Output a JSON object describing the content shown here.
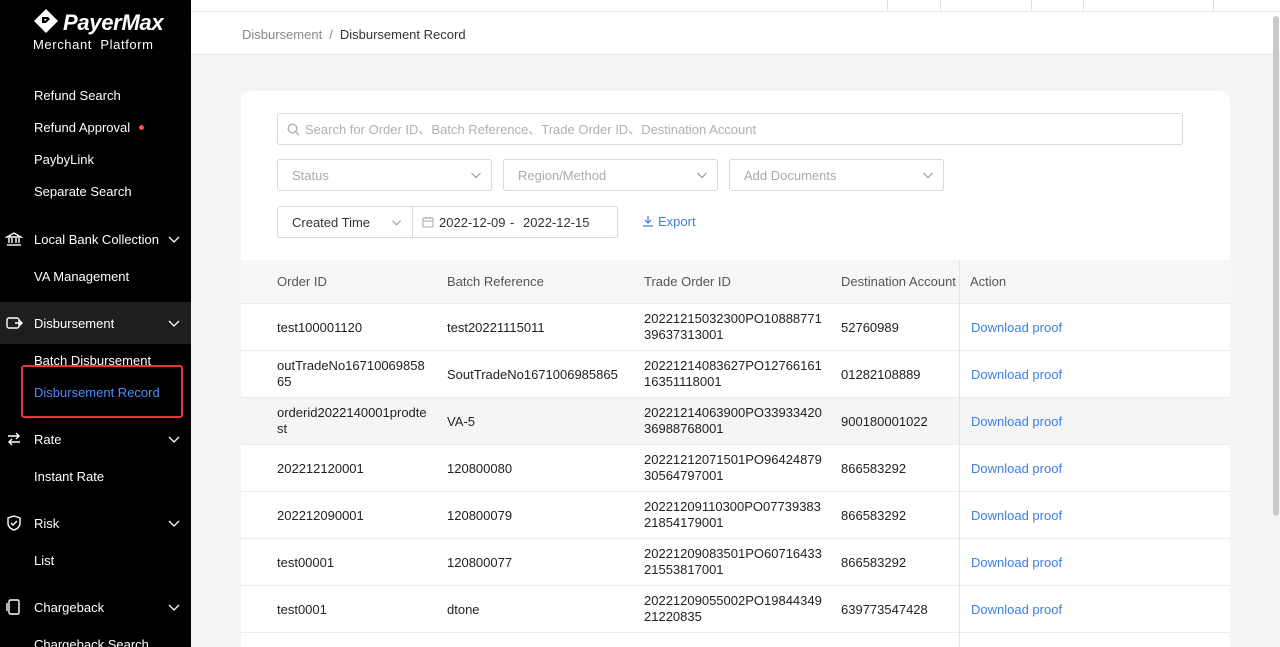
{
  "brand": {
    "name": "PayerMax",
    "subtitle": "Merchant  Platform"
  },
  "sidebar": {
    "items": [
      {
        "label": "Refund Search"
      },
      {
        "label": "Refund Approval"
      },
      {
        "label": "PaybyLink"
      },
      {
        "label": "Separate Search"
      },
      {
        "label": "Local Bank Collection"
      },
      {
        "label": "VA Management"
      },
      {
        "label": "Disbursement"
      },
      {
        "label": "Batch Disbursement"
      },
      {
        "label": "Disbursement Record"
      },
      {
        "label": "Rate"
      },
      {
        "label": "Instant Rate"
      },
      {
        "label": "Risk"
      },
      {
        "label": "List"
      },
      {
        "label": "Chargeback"
      },
      {
        "label": "Chargeback Search"
      }
    ],
    "accent_color": "#4a8cff",
    "badge_color": "#ff4d4f"
  },
  "breadcrumb": {
    "parent": "Disbursement",
    "separator": "/",
    "current": "Disbursement Record"
  },
  "filters": {
    "search_placeholder": "Search for Order ID、Batch Reference、Trade Order ID、Destination Account",
    "status_placeholder": "Status",
    "region_placeholder": "Region/Method",
    "documents_placeholder": "Add Documents",
    "time_type": "Created Time",
    "date_from": "2022-12-09",
    "date_sep": "-",
    "date_to": "2022-12-15",
    "export_label": "Export"
  },
  "table": {
    "columns": [
      "Order ID",
      "Batch Reference",
      "Trade Order ID",
      "Destination Account",
      "Action"
    ],
    "rows": [
      {
        "order_id": "test100001120",
        "batch_ref": "test20221115011",
        "trade_order_id": "20221215032300PO1088877139637313001",
        "destination": "52760989",
        "action": "Download proof"
      },
      {
        "order_id": "outTradeNo1671006985865",
        "batch_ref": "SoutTradeNo1671006985865",
        "trade_order_id": "20221214083627PO1276616116351118001",
        "destination": "01282108889",
        "action": "Download proof"
      },
      {
        "order_id": "orderid2022140001prodtest",
        "batch_ref": "VA-5",
        "trade_order_id": "20221214063900PO3393342036988768001",
        "destination": "900180001022",
        "action": "Download proof"
      },
      {
        "order_id": "202212120001",
        "batch_ref": "120800080",
        "trade_order_id": "20221212071501PO9642487930564797001",
        "destination": "866583292",
        "action": "Download proof"
      },
      {
        "order_id": "202212090001",
        "batch_ref": "120800079",
        "trade_order_id": "20221209110300PO0773938321854179001",
        "destination": "866583292",
        "action": "Download proof"
      },
      {
        "order_id": "test00001",
        "batch_ref": "120800077",
        "trade_order_id": "20221209083501PO6071643321553817001",
        "destination": "866583292",
        "action": "Download proof"
      },
      {
        "order_id": "test0001",
        "batch_ref": "dtone",
        "trade_order_id": "20221209055002PO1984434921220835",
        "destination": "639773547428",
        "action": "Download proof"
      }
    ]
  },
  "link_color": "#3d7fe3"
}
